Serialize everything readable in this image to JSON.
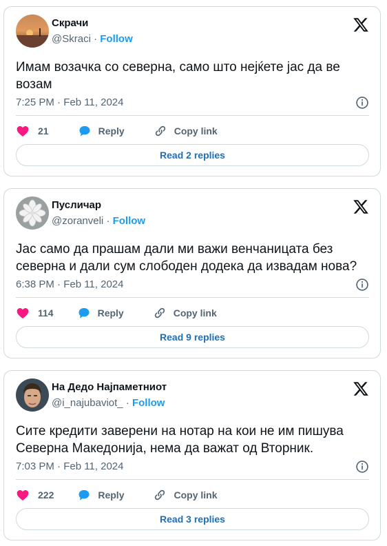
{
  "tweets": [
    {
      "name": "Скрачи",
      "handle": "@Skraci",
      "separator": "·",
      "follow": "Follow",
      "text": "Имам возачка со северна, само што нејќете јас да ве возам",
      "time": "7:25 PM · Feb 11, 2024",
      "likes": "21",
      "reply": "Reply",
      "copy_link": "Copy link",
      "read_replies": "Read 2 replies"
    },
    {
      "name": "Пусличар",
      "handle": "@zoranveli",
      "separator": "·",
      "follow": "Follow",
      "text": "Јас само да прашам дали ми важи венчаницата без северна и дали сум слободен додека да извадам нова?",
      "time": "6:38 PM · Feb 11, 2024",
      "likes": "114",
      "reply": "Reply",
      "copy_link": "Copy link",
      "read_replies": "Read 9 replies"
    },
    {
      "name": "На Дедо Најпаметниот",
      "handle": "@i_najubaviot_",
      "separator": "·",
      "follow": "Follow",
      "text": "Сите кредити заверени на нотар на кои не им пишува Северна Македонија, нема да важат од Вторник.",
      "time": "7:03 PM · Feb 11, 2024",
      "likes": "222",
      "reply": "Reply",
      "copy_link": "Copy link",
      "read_replies": "Read 3 replies"
    }
  ],
  "icons": {
    "logo": "x-logo-icon",
    "info": "info-icon",
    "like": "heart-icon",
    "reply": "reply-bubble-icon",
    "copy": "link-icon"
  },
  "colors": {
    "like": "#f91880",
    "reply": "#1d9bf0",
    "follow": "#1d9bf0",
    "read_replies": "#1d6fb8",
    "muted": "#536471",
    "border": "#cfd9de"
  }
}
